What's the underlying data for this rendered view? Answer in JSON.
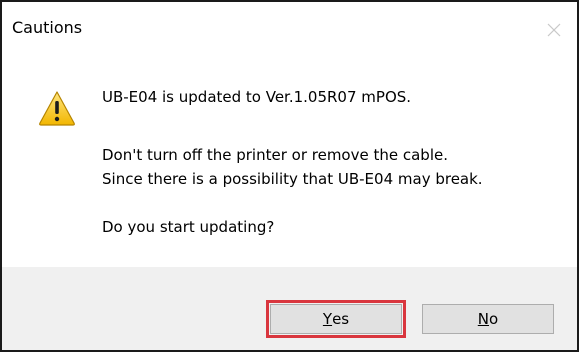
{
  "dialog": {
    "title": "Cautions",
    "close_icon": "close-icon",
    "warning_icon": "warning-triangle-icon",
    "messages": {
      "line1": "UB-E04 is updated to Ver.1.05R07 mPOS.",
      "line2": "Don't turn off the printer or remove the cable.",
      "line3": "Since there is a possibility that UB-E04 may break.",
      "line4": "Do you start updating?"
    },
    "buttons": {
      "yes": {
        "mnemonic": "Y",
        "rest": "es"
      },
      "no": {
        "mnemonic": "N",
        "rest": "o"
      }
    },
    "colors": {
      "highlight_border": "#d9363e",
      "warning_fill": "#f6c700",
      "footer_bg": "#f0f0f0"
    }
  }
}
